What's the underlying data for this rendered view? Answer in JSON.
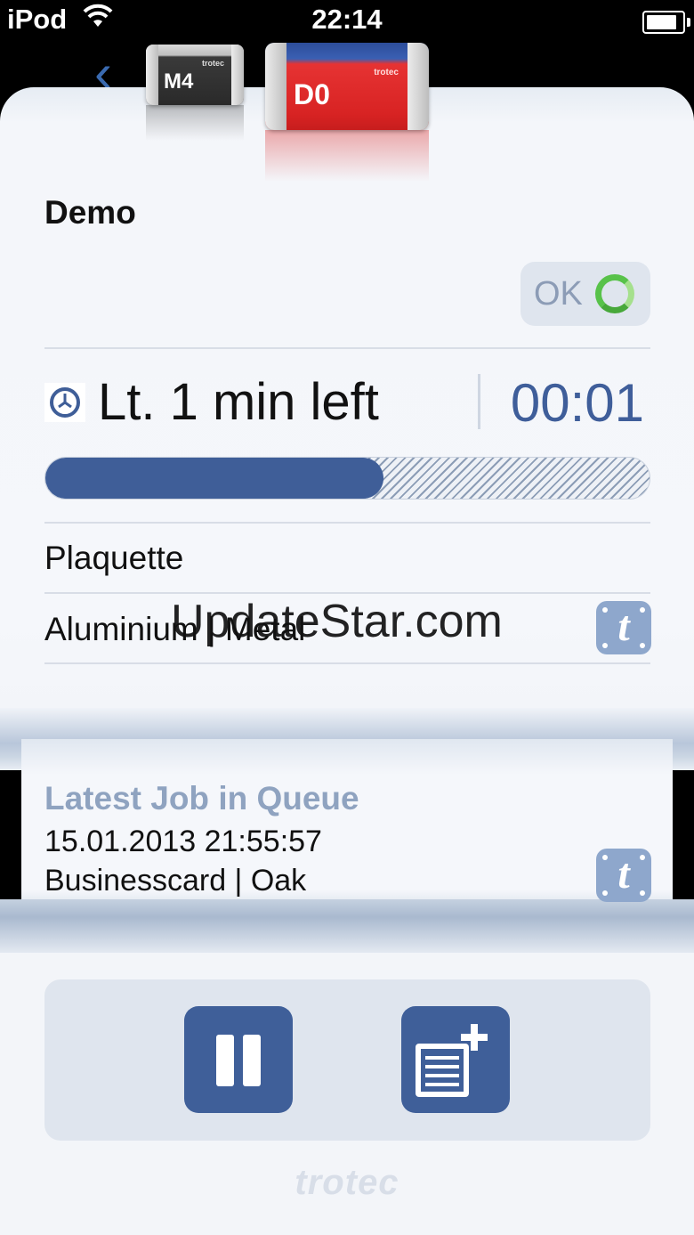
{
  "status_bar": {
    "carrier": "iPod",
    "time": "22:14"
  },
  "machines": [
    {
      "label": "M4",
      "brand": "trotec",
      "color": "#2e2e2e",
      "selected": false
    },
    {
      "label": "D0",
      "brand": "trotec",
      "color": "#dd2727",
      "selected": true
    }
  ],
  "header": {
    "title": "Demo"
  },
  "status": {
    "label": "OK",
    "color": "#58c24a"
  },
  "job": {
    "time_left": "Lt. 1 min left",
    "elapsed": "00:01",
    "progress_percent": 56,
    "name": "Plaquette",
    "material": "Aluminium | Metal"
  },
  "watermark": "UpdateStar.com",
  "queue": {
    "heading": "Latest Job in Queue",
    "date": "15.01.2013 21:55:57",
    "job": "Businesscard | Oak"
  },
  "controls": {
    "pause_icon": "pause-icon",
    "add_job_icon": "add-job-icon"
  },
  "footer": {
    "brand": "trotec"
  },
  "colors": {
    "accent": "#3f5e98",
    "heading_muted": "#8fa3c0",
    "t_button": "#8ea7cc"
  }
}
